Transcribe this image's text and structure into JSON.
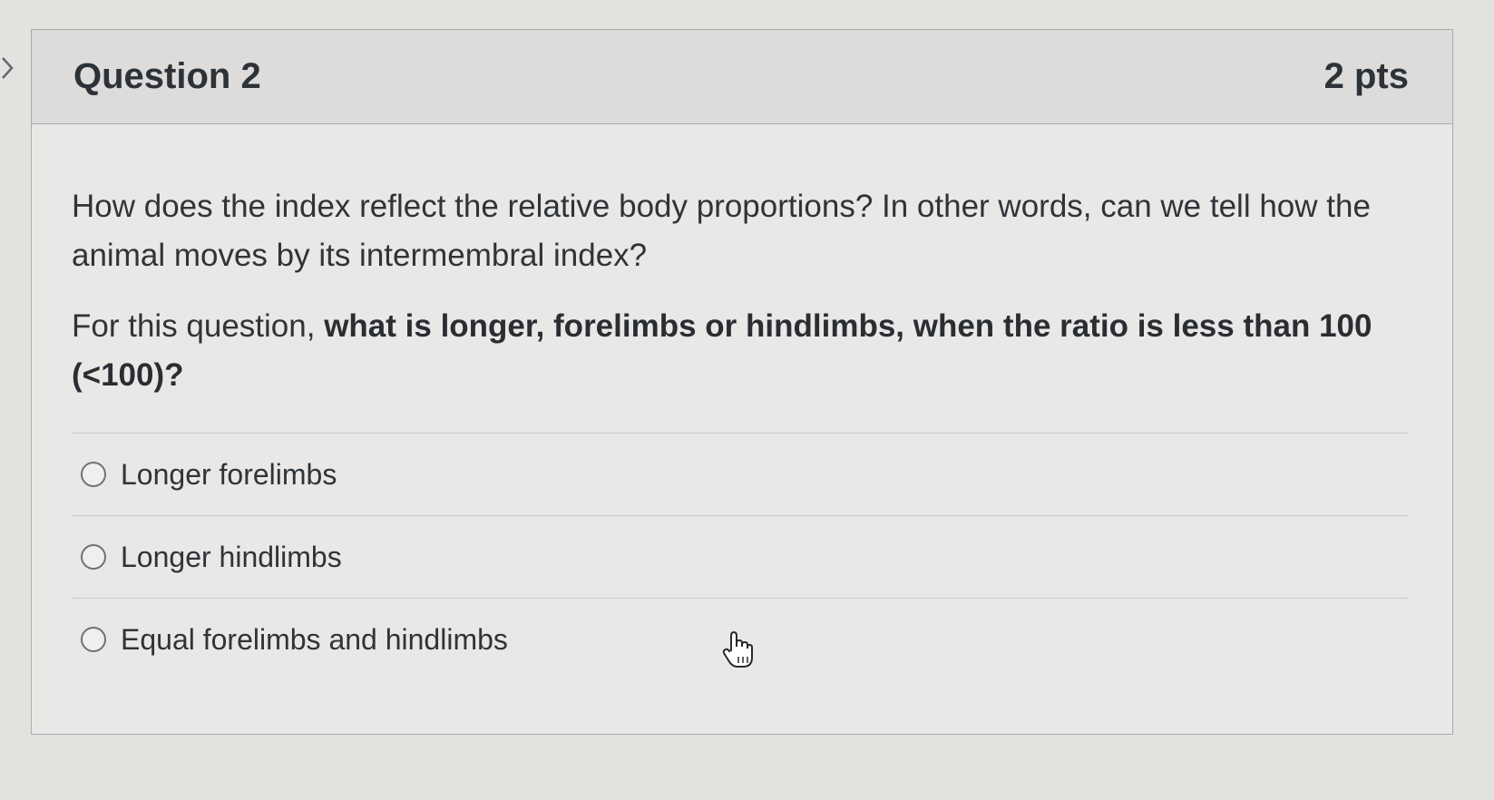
{
  "question": {
    "title": "Question 2",
    "points": "2 pts",
    "prompt": "How does the index reflect the relative body proportions? In other words, can we tell how the animal moves by its intermembral index?",
    "instruction_prefix": "For this question, ",
    "instruction_bold": "what is longer, forelimbs or hindlimbs, when the ratio is less than 100 (<100)?"
  },
  "answers": [
    {
      "label": "Longer forelimbs",
      "selected": false
    },
    {
      "label": "Longer hindlimbs",
      "selected": false
    },
    {
      "label": "Equal forelimbs and hindlimbs",
      "selected": false
    }
  ],
  "icons": {
    "collapse": "chevron-right-icon",
    "cursor": "hand-pointer-icon"
  },
  "colors": {
    "background": "#e4e2df",
    "header": "#dddcda",
    "border": "#a9acae",
    "text": "#2f3439"
  }
}
